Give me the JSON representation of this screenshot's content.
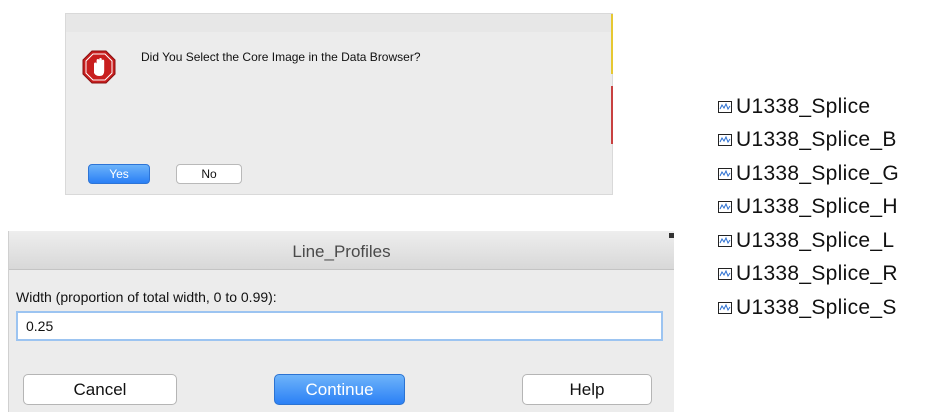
{
  "alert": {
    "message": "Did You Select the Core Image in the Data Browser?",
    "yes_label": "Yes",
    "no_label": "No",
    "icon": "stop-hand-icon"
  },
  "line_profiles": {
    "title": "Line_Profiles",
    "width_label": "Width (proportion of total width, 0 to 0.99):",
    "width_value": "0.25",
    "cancel_label": "Cancel",
    "continue_label": "Continue",
    "help_label": "Help"
  },
  "waves": {
    "icon": "wave-icon",
    "items": [
      {
        "label": "U1338_Splice"
      },
      {
        "label": "U1338_Splice_B"
      },
      {
        "label": "U1338_Splice_G"
      },
      {
        "label": "U1338_Splice_H"
      },
      {
        "label": "U1338_Splice_L"
      },
      {
        "label": "U1338_Splice_R"
      },
      {
        "label": "U1338_Splice_S"
      }
    ]
  },
  "colors": {
    "accent_blue": "#2a7ff5",
    "stop_red": "#c81e1e",
    "dialog_bg": "#ececec"
  }
}
